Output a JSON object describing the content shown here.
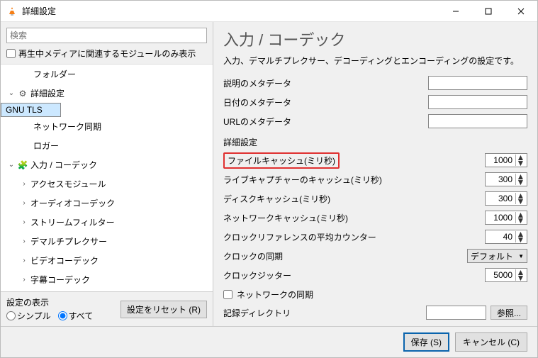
{
  "window": {
    "title": "詳細設定"
  },
  "search": {
    "placeholder": "検索"
  },
  "left": {
    "only_related": "再生中メディアに関連するモジュールのみ表示",
    "items": {
      "folder": "フォルダー",
      "advanced": "詳細設定",
      "gnutls": "GNU TLS",
      "netsync": "ネットワーク同期",
      "logger": "ロガー",
      "input_codec": "入力 / コーデック",
      "access": "アクセスモジュール",
      "audio_codec": "オーディオコーデック",
      "stream_filter": "ストリームフィルター",
      "demux": "デマルチプレクサー",
      "video_codec": "ビデオコーデック",
      "sub_codec": "字幕コーデック"
    },
    "display_group": "設定の表示",
    "simple": "シンプル",
    "all": "すべて",
    "reset": "設定をリセット (R)"
  },
  "right": {
    "heading": "入力 / コーデック",
    "subtitle": "入力、デマルチプレクサー、デコーディングとエンコーディングの設定です。",
    "meta_desc": "説明のメタデータ",
    "meta_date": "日付のメタデータ",
    "meta_url": "URLのメタデータ",
    "section_adv": "詳細設定",
    "file_cache": "ファイルキャッシュ(ミリ秒)",
    "live_cache": "ライブキャプチャーのキャッシュ(ミリ秒)",
    "disk_cache": "ディスクキャッシュ(ミリ秒)",
    "net_cache": "ネットワークキャッシュ(ミリ秒)",
    "clock_ref": "クロックリファレンスの平均カウンター",
    "clock_sync": "クロックの同期",
    "clock_jitter": "クロックジッター",
    "net_sync": "ネットワークの同期",
    "record_dir": "記録ディレクトリ",
    "browse": "参照...",
    "vals": {
      "file_cache": "1000",
      "live_cache": "300",
      "disk_cache": "300",
      "net_cache": "1000",
      "clock_ref": "40",
      "clock_sync_sel": "デフォルト",
      "clock_jitter": "5000"
    }
  },
  "footer": {
    "save": "保存 (S)",
    "cancel": "キャンセル (C)"
  }
}
